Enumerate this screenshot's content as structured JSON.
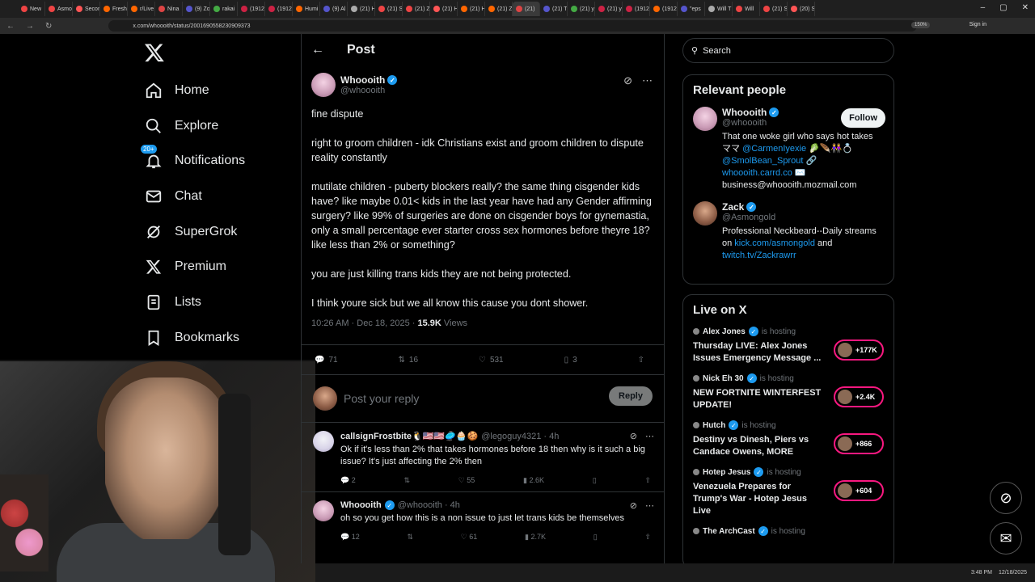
{
  "browser": {
    "tabs": [
      "New",
      "Asmo",
      "Secon",
      "Fresh",
      "r/Live",
      "Nina",
      "(9) Zo",
      "rakai",
      "(1912",
      "(1912",
      "Humi",
      "(9) Al",
      "(21) H",
      "(21) S",
      "(21) Z",
      "(21) H",
      "(21) H",
      "(21) Z",
      "(21)",
      "(21) T",
      "(21) y",
      "(21) y",
      "(1912",
      "(1912",
      "\"eps",
      "Will T",
      "Will",
      "(21) S",
      "(20) S"
    ],
    "url": "x.com/whoooith/status/2001690558230909373",
    "zoom": "150%",
    "signin": "Sign in",
    "minimize": "–",
    "restore": "▢",
    "close": "✕"
  },
  "nav": {
    "items": [
      {
        "label": "Home",
        "icon": "home-icon"
      },
      {
        "label": "Explore",
        "icon": "search-icon"
      },
      {
        "label": "Notifications",
        "icon": "bell-icon",
        "badge": "20+"
      },
      {
        "label": "Chat",
        "icon": "mail-icon"
      },
      {
        "label": "SuperGrok",
        "icon": "grok-icon"
      },
      {
        "label": "Premium",
        "icon": "x-icon"
      },
      {
        "label": "Lists",
        "icon": "list-icon"
      },
      {
        "label": "Bookmarks",
        "icon": "bookmark-icon"
      }
    ]
  },
  "post": {
    "header_title": "Post",
    "author_name": "Whoooith",
    "author_handle": "@whoooith",
    "paragraphs": [
      "fine dispute",
      "right to groom children - idk Christians exist and groom children to dispute reality constantly",
      "mutilate children - puberty blockers really? the same thing cisgender kids have? like maybe 0.01< kids in the last year have had any Gender affirming surgery? like 99% of surgeries are done on cisgender boys for gynemastia, only a small percentage ever starter cross sex hormones before theyre 18? like less than 2% or something?",
      "you are just killing trans kids they are not being protected.",
      "I think youre sick but we all know this cause you dont shower."
    ],
    "time": "10:26 AM · Dec 18, 2025 · ",
    "views_count": "15.9K",
    "views_label": " Views",
    "replies": "71",
    "reposts": "16",
    "likes": "531",
    "bookmarks": "3"
  },
  "reply_box": {
    "placeholder": "Post your reply",
    "button": "Reply"
  },
  "replies": [
    {
      "name": "callsignFrostbite🐧🇺🇸🇺🇸🥏🧁🍪",
      "handle": "@legoguy4321 · 4h",
      "text": "Ok if it's less than 2% that takes hormones before 18 then why is it such a big issue? It's just affecting the 2% then",
      "replies": "2",
      "likes": "55",
      "views": "2.6K"
    },
    {
      "name": "Whoooith",
      "handle": "@whoooith · 4h",
      "text": "oh so you get how this is a non issue to just let trans kids be themselves",
      "replies": "12",
      "likes": "61",
      "views": "2.7K"
    }
  ],
  "sidebar": {
    "search_placeholder": "Search",
    "relevant_title": "Relevant people",
    "people": [
      {
        "name": "Whoooith",
        "handle": "@whoooith",
        "follow": "Follow",
        "bio_text": "That one woke girl who says hot takes ママ ",
        "bio_link1": "@CarmenIyexie",
        "bio_emoji": " 🥬🪶👭💍",
        "bio_link2": "@SmolBean_Sprout",
        "bio_emoji2": " 🔗",
        "bio_link3": "whoooith.carrd.co",
        "bio_emoji3": " ✉️",
        "bio_email": "business@whoooith.mozmail.com"
      },
      {
        "name": "Zack",
        "handle": "@Asmongold",
        "bio_text": "Professional Neckbeard--Daily streams on ",
        "bio_link1": "kick.com/asmongold",
        "bio_mid": " and ",
        "bio_link2": "twitch.tv/Zackrawrr"
      }
    ],
    "live_title": "Live on X",
    "live": [
      {
        "host": "Alex Jones",
        "status": "is hosting",
        "title": "Thursday LIVE: Alex Jones Issues Emergency Message ...",
        "count": "+177K"
      },
      {
        "host": "Nick Eh 30",
        "status": "is hosting",
        "title": "NEW FORTNITE WINTERFEST UPDATE!",
        "count": "+2.4K"
      },
      {
        "host": "Hutch",
        "status": "is hosting",
        "title": "Destiny vs Dinesh, Piers vs Candace Owens, MORE",
        "count": "+866"
      },
      {
        "host": "Hotep Jesus",
        "status": "is hosting",
        "title": "Venezuela Prepares for Trump's War - Hotep Jesus Live",
        "count": "+604"
      },
      {
        "host": "The ArchCast",
        "status": "is hosting",
        "title": "",
        "count": ""
      }
    ]
  },
  "taskbar": {
    "time": "3:48 PM",
    "date": "12/18/2025"
  },
  "colors": {
    "accent": "#1d9bf0",
    "live": "#f91880",
    "background": "#000000",
    "border": "#2f3336"
  }
}
